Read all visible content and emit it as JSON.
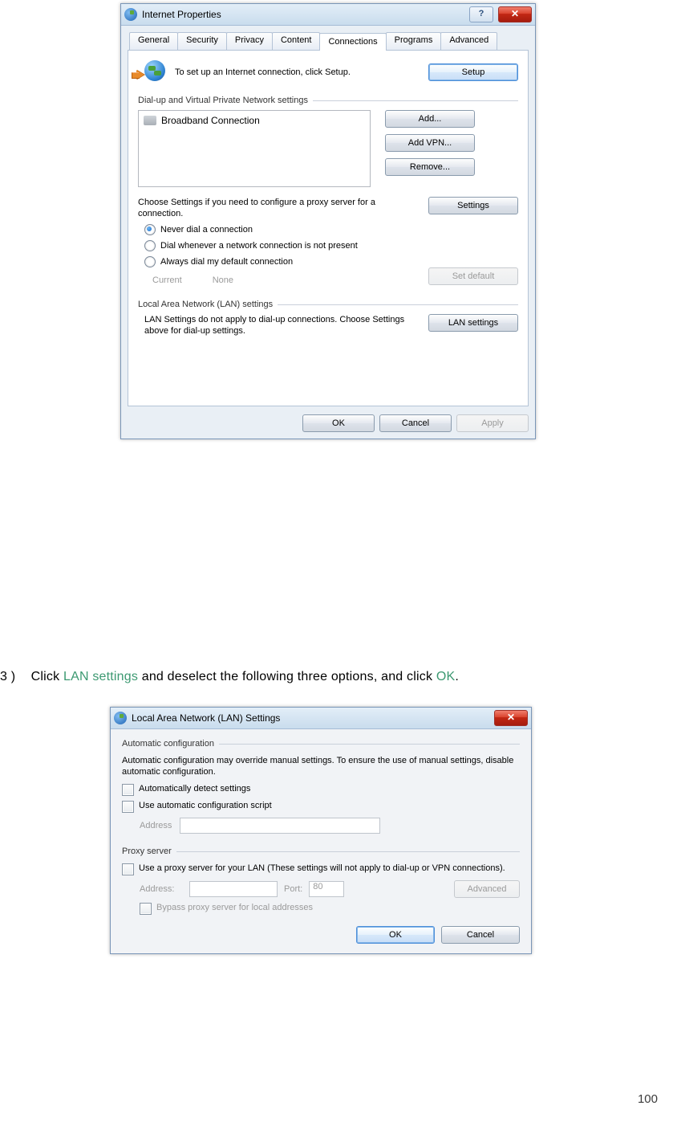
{
  "page_number": "100",
  "instruction": {
    "num": "3 )",
    "pre": "Click ",
    "link1": "LAN settings",
    "mid": " and deselect the following three options, and click ",
    "link2": "OK",
    "post": "."
  },
  "ip": {
    "title": "Internet Properties",
    "help_glyph": "?",
    "close_glyph": "✕",
    "tabs": [
      "General",
      "Security",
      "Privacy",
      "Content",
      "Connections",
      "Programs",
      "Advanced"
    ],
    "selected_tab_index": 4,
    "intro": "To set up an Internet connection, click Setup.",
    "setup_btn": "Setup",
    "dialup_legend": "Dial-up and Virtual Private Network settings",
    "connection_item": "Broadband Connection",
    "add_btn": "Add...",
    "add_vpn_btn": "Add VPN...",
    "remove_btn": "Remove...",
    "proxy_note": "Choose Settings if you need to configure a proxy server for a connection.",
    "settings_btn": "Settings",
    "radio1": "Never dial a connection",
    "radio2": "Dial whenever a network connection is not present",
    "radio3": "Always dial my default connection",
    "current_label": "Current",
    "current_value": "None",
    "set_default_btn": "Set default",
    "lan_legend": "Local Area Network (LAN) settings",
    "lan_note": "LAN Settings do not apply to dial-up connections. Choose Settings above for dial-up settings.",
    "lan_settings_btn": "LAN settings",
    "ok_btn": "OK",
    "cancel_btn": "Cancel",
    "apply_btn": "Apply"
  },
  "lan": {
    "title": "Local Area Network (LAN) Settings",
    "close_glyph": "✕",
    "auto_legend": "Automatic configuration",
    "auto_text": "Automatic configuration may override manual settings.  To ensure the use of manual settings, disable automatic configuration.",
    "chk_detect": "Automatically detect settings",
    "chk_script": "Use automatic configuration script",
    "address_label": "Address",
    "proxy_legend": "Proxy server",
    "chk_proxy": "Use a proxy server for your LAN (These settings will not apply to dial-up or VPN connections).",
    "addr2_label": "Address:",
    "port_label": "Port:",
    "port_value": "80",
    "advanced_btn": "Advanced",
    "chk_bypass": "Bypass proxy server for local addresses",
    "ok_btn": "OK",
    "cancel_btn": "Cancel"
  }
}
